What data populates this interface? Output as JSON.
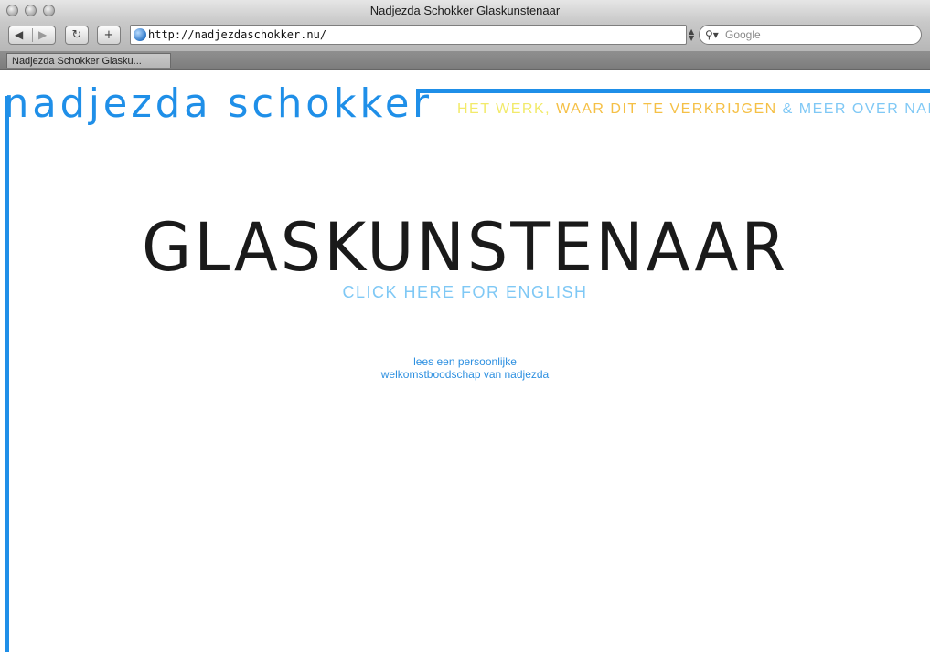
{
  "window": {
    "title": "Nadjezda Schokker Glaskunstenaar"
  },
  "toolbar": {
    "back_icon": "back-arrow-icon",
    "forward_icon": "forward-arrow-icon",
    "reload_icon": "reload-icon",
    "add_icon": "plus-icon",
    "url": "http://nadjezdaschokker.nu/",
    "search_placeholder": "Google"
  },
  "tabs": [
    {
      "label": "Nadjezda Schokker Glasku..."
    }
  ],
  "site": {
    "logo": "nadjezda schokker",
    "nav": {
      "work": "HET WERK,",
      "where": "WAAR DIT TE VERKRIJGEN",
      "more": "& MEER OVER NADJEZDA"
    },
    "headline": "GLASKUNSTENAAR",
    "english_link": "CLICK HERE FOR ENGLISH",
    "welcome_line1": "lees een persoonlijke",
    "welcome_line2": "welkomstboodschap van nadjezda"
  },
  "colors": {
    "brand_blue": "#1f8fe8",
    "nav_yellow": "#f2ea6a",
    "nav_orange": "#f5c046",
    "nav_lightblue": "#7fc8f5",
    "headline": "#1a1a1a"
  }
}
